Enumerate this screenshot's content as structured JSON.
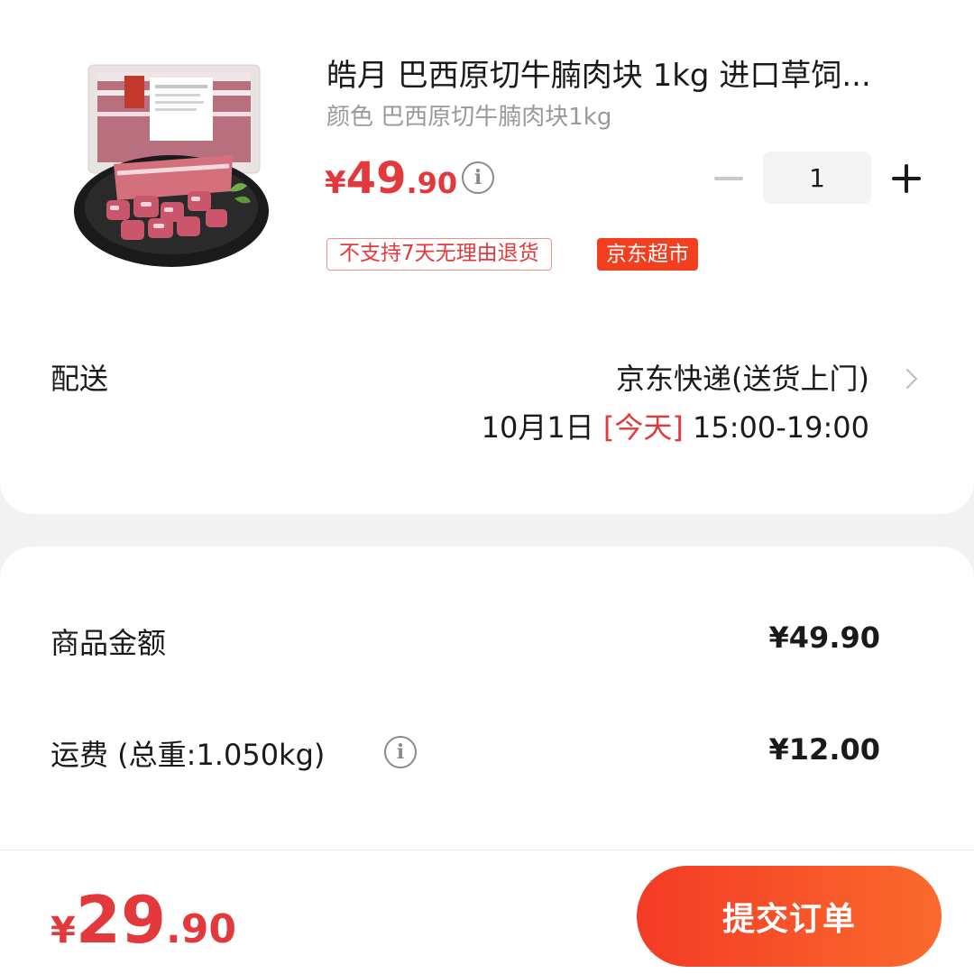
{
  "product": {
    "image_icon": "beef-brisket-package-icon",
    "title": "皓月 巴西原切牛腩肉块 1kg 进口草饲...",
    "variant": "颜色 巴西原切牛腩肉块1kg",
    "price_symbol": "¥",
    "price_integer": "49",
    "price_decimal": ".90",
    "price_info_icon": "i",
    "quantity": "1",
    "tags": {
      "return_policy": "不支持7天无理由退货",
      "store": "京东超市"
    }
  },
  "delivery": {
    "label": "配送",
    "method": "京东快递(送货上门)",
    "date": "10月1日",
    "day_tag": "[今天]",
    "time_window": "15:00-19:00"
  },
  "summary": {
    "goods_label": "商品金额",
    "goods_amount": "¥49.90",
    "shipping_label": "运费 (总重:1.050kg)",
    "shipping_info_icon": "i",
    "shipping_amount": "¥12.00"
  },
  "footer": {
    "total_symbol": "¥",
    "total_integer": "29",
    "total_decimal": ".90",
    "submit_label": "提交订单"
  },
  "colors": {
    "accent": "#e4393c",
    "store_tag": "#f23f1f",
    "button_start": "#f33b26",
    "button_end": "#fb6a2c",
    "page_background": "#f2f2f2"
  }
}
